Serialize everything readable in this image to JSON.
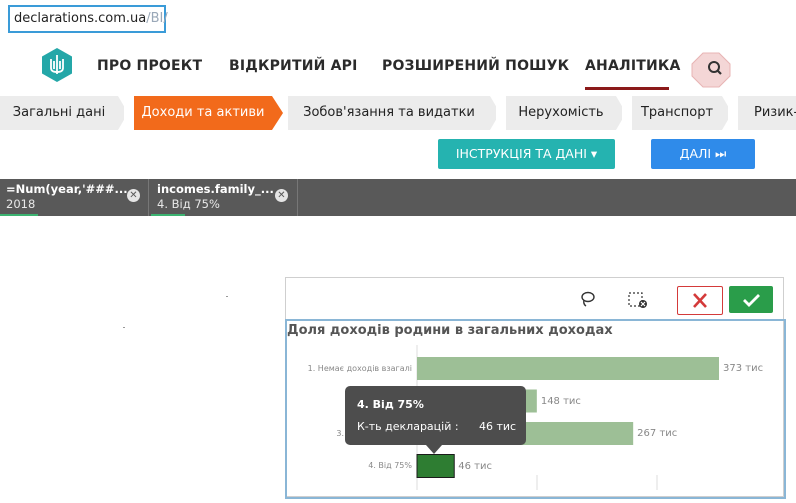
{
  "url": {
    "domain": "declarations.com.ua",
    "path": "/BI/"
  },
  "nav": {
    "items": [
      "ПРО ПРОЕКТ",
      "ВІДКРИТИЙ API",
      "РОЗШИРЕНИЙ ПОШУК",
      "АНАЛІТИКА"
    ],
    "active": "АНАЛІТИКА",
    "active_color": "#8b1a1a"
  },
  "tabs": [
    "Загальні дані",
    "Доходи та активи",
    "Зобов'язання та видатки",
    "Нерухомість",
    "Транспорт",
    "Ризик-"
  ],
  "active_tab": "Доходи та активи",
  "buttons": {
    "instructions": "ІНСТРУКЦІЯ ТА ДАНІ ▾",
    "next": "ДАЛІ ⏭"
  },
  "selections": [
    {
      "field": "=Num(year,'###...",
      "value": "2018"
    },
    {
      "field": "incomes.family_...",
      "value": "4. Від 75%"
    }
  ],
  "chart_data": {
    "type": "bar",
    "orientation": "horizontal",
    "title": "Доля доходів родини в загальних доходах",
    "categories": [
      "1. Немає доходів взагалі",
      "2.",
      "3.",
      "4. Від 75%"
    ],
    "values": [
      373,
      148,
      267,
      46
    ],
    "value_labels": [
      "373 тис",
      "148 тис",
      "267 тис",
      "46 тис"
    ],
    "unit": "тис",
    "selected_index": 3,
    "colors": {
      "bar": "#9dbf96",
      "selected": "#2e7d32"
    }
  },
  "tooltip": {
    "title": "4. Від 75%",
    "measure_label": "К-ть декларацій :",
    "measure_value": "46 тис"
  }
}
